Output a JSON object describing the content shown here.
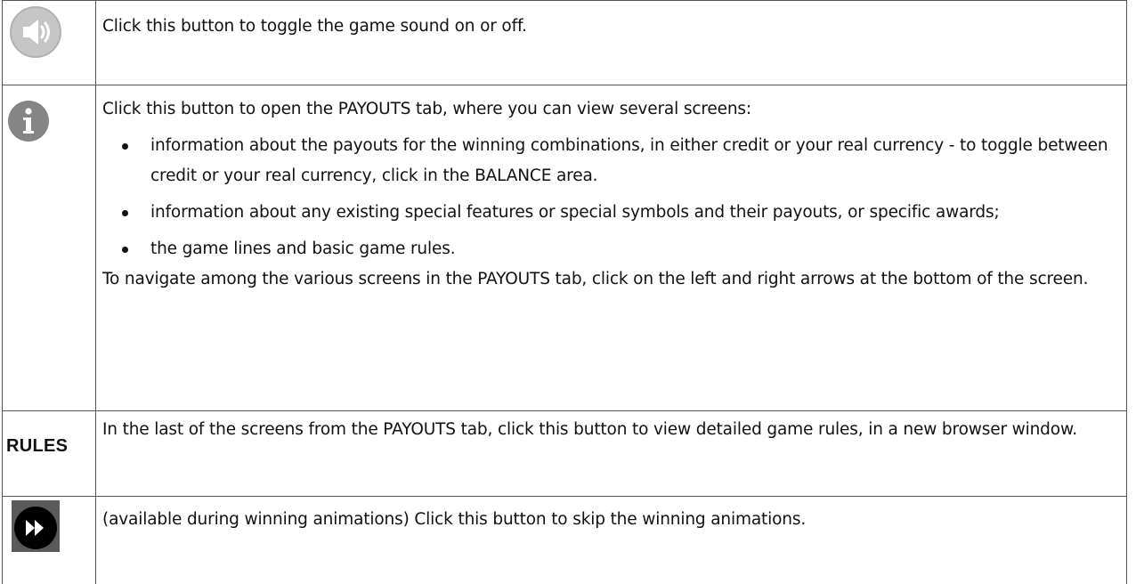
{
  "rows": [
    {
      "icon": "sound-icon",
      "text": "Click this button to toggle the game sound on or off."
    },
    {
      "icon": "info-icon",
      "intro": "Click this button to open the PAYOUTS tab, where you can view several screens:",
      "bullets": [
        "information about the payouts for the winning combinations, in either credit or your real currency - to toggle between credit or your real currency, click in the BALANCE area.",
        "information about any existing special features or special symbols and their payouts, or specific awards;",
        "the game lines and basic game rules."
      ],
      "outro": "To navigate among the various screens in the PAYOUTS tab, click on the left and right arrows at the bottom of the screen."
    },
    {
      "label": "RULES",
      "text": "In the last of the screens from the PAYOUTS tab, click this button to view detailed game rules, in a new browser window."
    },
    {
      "icon": "fast-forward-icon",
      "text": "(available during winning animations) Click this button to skip the winning animations."
    }
  ],
  "colors": {
    "sound_icon_bg": "#c6c6c6",
    "info_icon_bg": "#858585",
    "skip_icon_bg": "#5a5a5a",
    "border": "#555555"
  }
}
